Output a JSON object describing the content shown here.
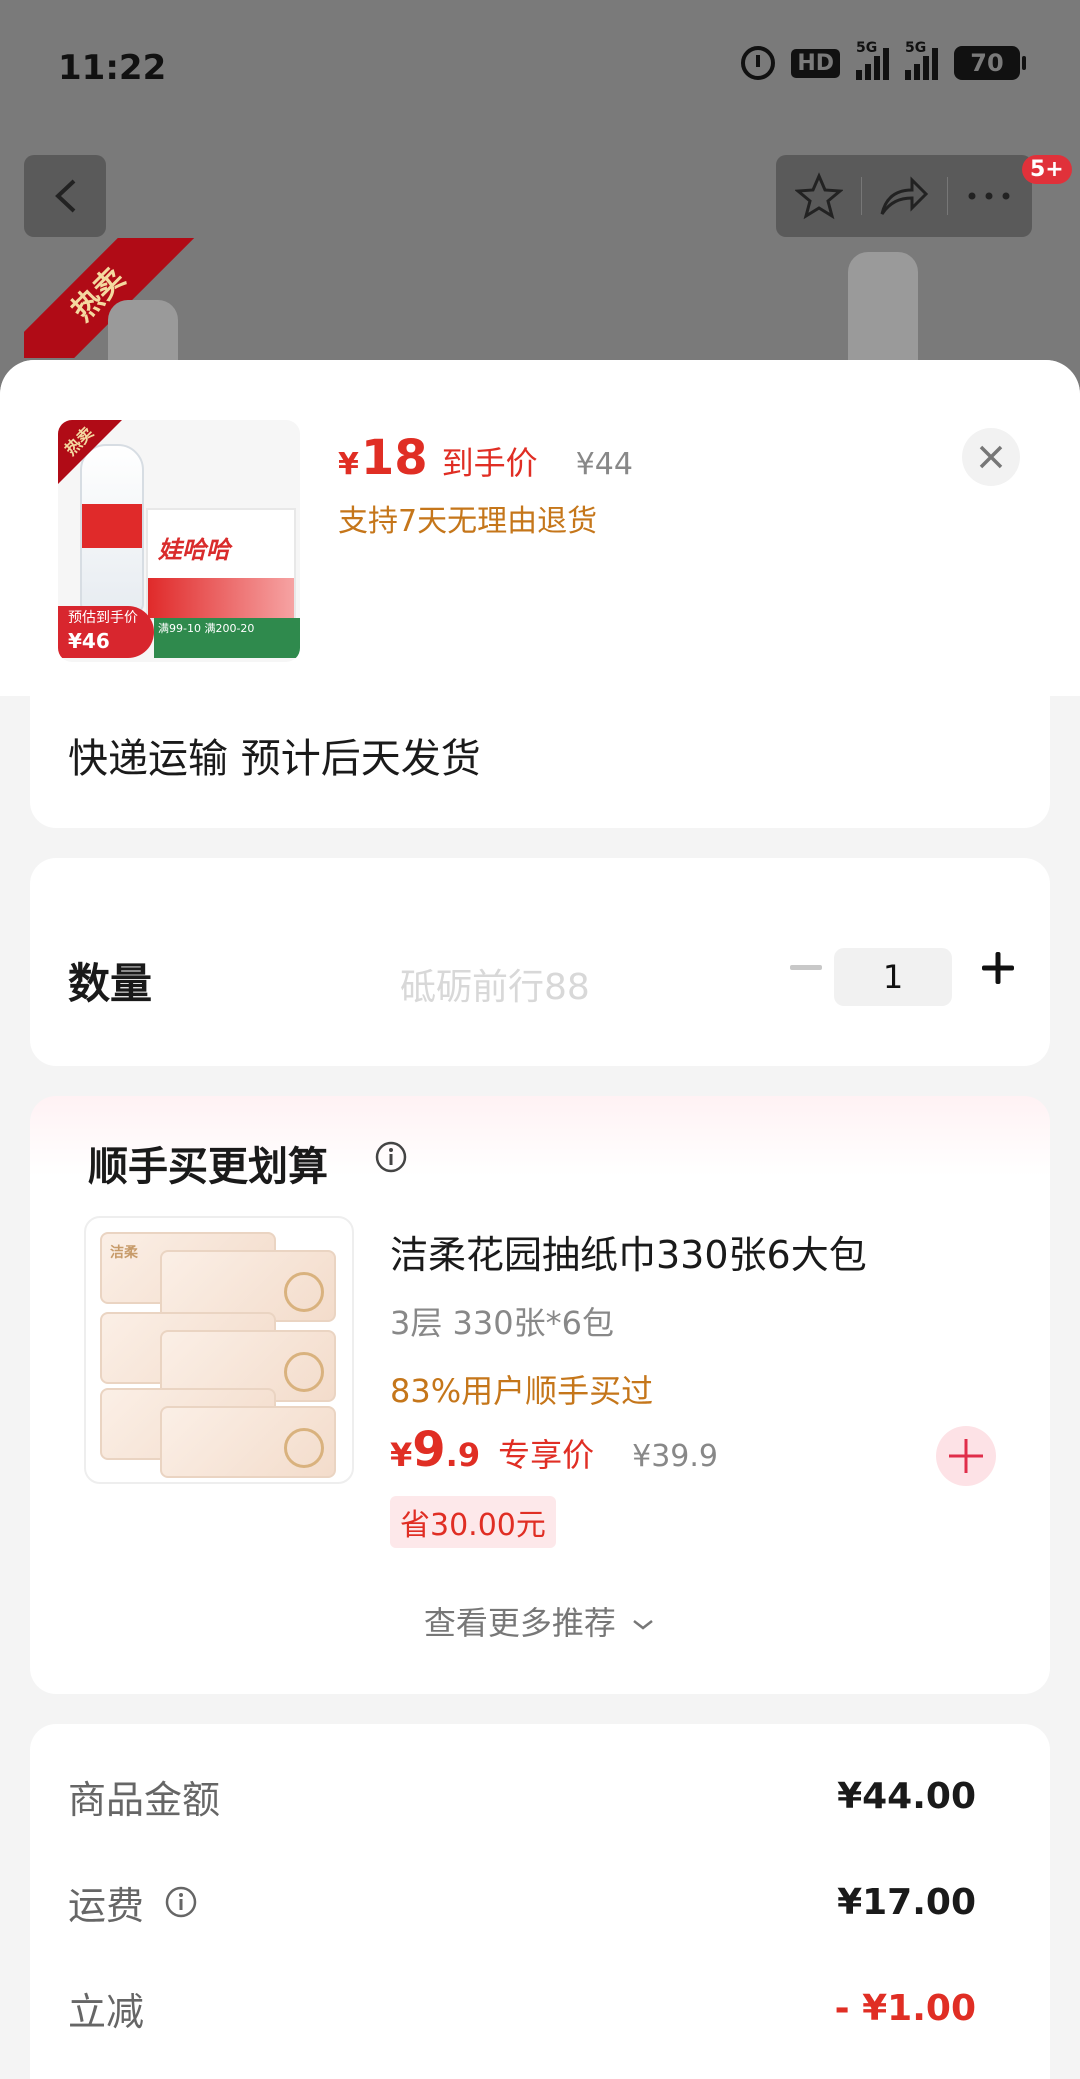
{
  "status_bar": {
    "time": "11:22",
    "hd_label": "HD",
    "signal1_label": "5G",
    "signal2_label": "5G",
    "battery": "70"
  },
  "background": {
    "hot_label": "热卖",
    "cart_badge": "5+"
  },
  "product": {
    "price_symbol": "¥",
    "price": "18",
    "price_tag": "到手价",
    "original_price": "¥44",
    "return_policy": "支持7天无理由退货",
    "thumb": {
      "brand": "娃哈哈",
      "hot": "热卖",
      "est_label": "预估到手价",
      "est_price": "¥46",
      "promo": "满99-10 满200-20"
    }
  },
  "shipping": {
    "text": "快递运输 预计后天发货"
  },
  "quantity": {
    "label": "数量",
    "value": "1",
    "watermark": "砥砺前行88"
  },
  "recommend": {
    "title": "顺手买更划算",
    "item": {
      "name": "洁柔花园抽纸巾330张6大包",
      "spec": "3层 330张*6包",
      "buyers": "83%用户顺手买过",
      "price_symbol": "¥",
      "price_int": "9",
      "price_dec": ".9",
      "price_tag": "专享价",
      "original_price": "¥39.9",
      "save": "省30.00元",
      "thumb_brand": "洁柔"
    },
    "more": "查看更多推荐"
  },
  "summary": {
    "rows": [
      {
        "label": "商品金额",
        "value": "¥44.00"
      },
      {
        "label": "运费",
        "value": "¥17.00"
      },
      {
        "label": "立减",
        "value": "- ¥1.00"
      }
    ]
  },
  "colors": {
    "accent": "#e02e24",
    "orange": "#c5761a",
    "overlay": "#7a7a7a"
  }
}
